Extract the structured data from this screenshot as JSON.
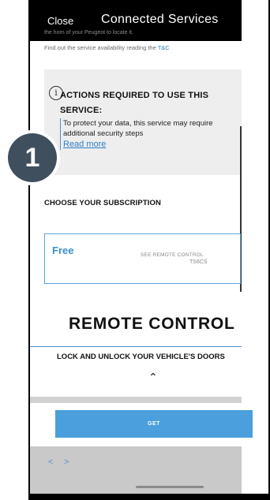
{
  "header": {
    "close_label": "Close",
    "title": "Connected Services",
    "cut_text": "the horn of your Peugeot to locate it."
  },
  "availability": {
    "text": "Find out the service availability reading the ",
    "link_label": "T&C"
  },
  "notice": {
    "icon": "info-icon",
    "title": "ACTIONS REQUIRED TO USE THIS SERVICE:",
    "body": "To protect your data, this service may require additional security steps",
    "read_more_label": "Read more"
  },
  "step_badge": "1",
  "subscription": {
    "heading": "CHOOSE YOUR SUBSCRIPTION",
    "plan_name": "Free",
    "see_label": "SEE REMOTE CONTROL",
    "plan_code": "TS6CS"
  },
  "service": {
    "title": "REMOTE CONTROL",
    "subtitle": "LOCK AND UNLOCK YOUR VEHICLE'S DOORS",
    "collapse_icon": "chevron-up-icon"
  },
  "get_label": "GET",
  "bottom_nav": {
    "back": "<",
    "forward": ">"
  },
  "colors": {
    "accent": "#4a9fdc",
    "link": "#2f7fc4",
    "badge": "#404f5e",
    "header_bg": "#000000"
  }
}
